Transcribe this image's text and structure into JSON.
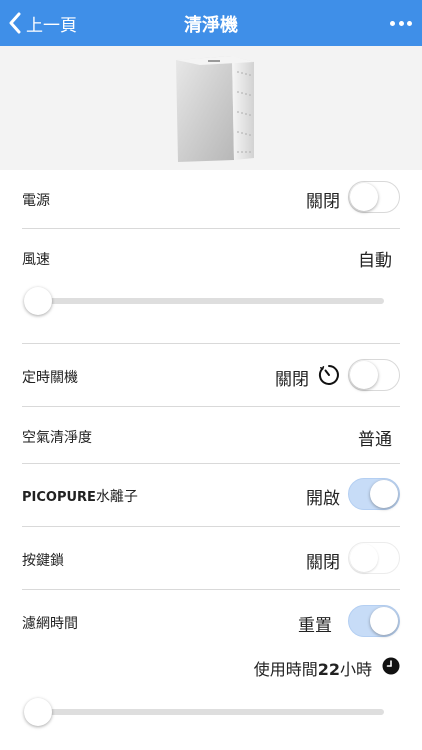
{
  "nav": {
    "back_label": "上一頁",
    "title": "清淨機",
    "bar_color": "#3f8fe8",
    "back_icon": "chevron-left-icon",
    "more_icon": "more-dots-icon"
  },
  "hero": {
    "image_alt": "air-purifier-product-image"
  },
  "settings": {
    "power": {
      "label": "電源",
      "value": "關閉",
      "toggle_on": false
    },
    "fan_speed": {
      "label": "風速",
      "value": "自動",
      "slider_level": 0
    },
    "timer_off": {
      "label": "定時關機",
      "value": "關閉",
      "toggle_on": false,
      "icon": "timer-icon"
    },
    "air_quality": {
      "label": "空氣清淨度",
      "value": "普通"
    },
    "picopure": {
      "label_brand": "PICOPURE",
      "label_suffix": "水離子",
      "value": "開啟",
      "toggle_on": true
    },
    "key_lock": {
      "label": "按鍵鎖",
      "value": "關閉",
      "toggle_on": false
    },
    "filter_time": {
      "label": "濾網時間",
      "value": "重置",
      "toggle_on": true
    },
    "usage": {
      "prefix": "使用時間",
      "hours": "22",
      "suffix": "小時",
      "icon": "clock-icon",
      "slider_level": 0
    }
  },
  "colors": {
    "toggle_on": "#c7dcf7",
    "divider": "#d9d9d9"
  }
}
